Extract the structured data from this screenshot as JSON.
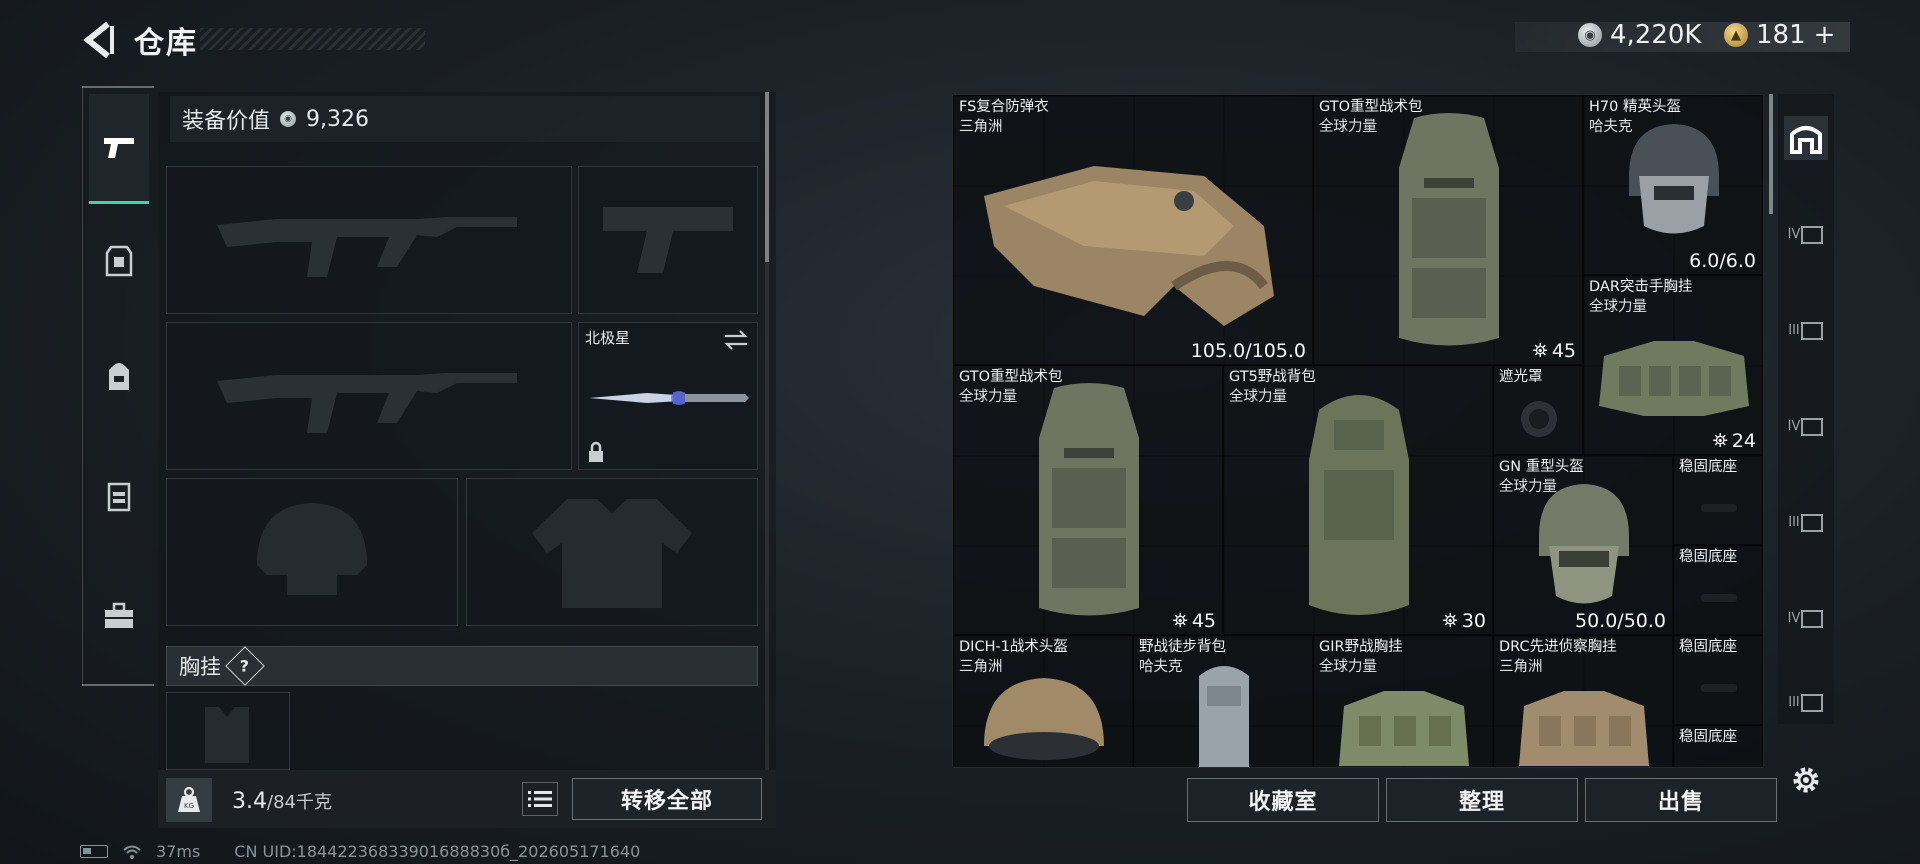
{
  "header": {
    "title": "仓库"
  },
  "currency": {
    "silver": "4,220K",
    "gold": "181",
    "gold_add": "+"
  },
  "left_panel": {
    "value_label": "装备价值",
    "value": "9,326",
    "melee_name": "北极星",
    "chest_label": "胸挂",
    "chest_help": "?",
    "weight_value": "3.4",
    "weight_cap": "/84千克",
    "transfer_all": "转移全部"
  },
  "footer": {
    "ping": "37ms",
    "uid": "CN UID:18442236833901688830б_202605171640"
  },
  "stash": {
    "items": [
      {
        "name": "FS复合防弹衣",
        "sub": "三角洲",
        "stat": "105.0/105.0",
        "rarity": "red",
        "icon": "body-armor-icon"
      },
      {
        "name": "GTO重型战术包",
        "sub": "全球力量",
        "stat": "45",
        "rarity": "red",
        "icon": "tactical-backpack-icon"
      },
      {
        "name": "H70 精英头盔",
        "sub": "哈夫克",
        "stat": "6.0/6.0",
        "rarity": "red",
        "icon": "elite-helmet-icon"
      },
      {
        "name": "DAR突击手胸挂",
        "sub": "全球力量",
        "stat": "24",
        "rarity": "red",
        "icon": "chest-rig-icon"
      },
      {
        "name": "GTO重型战术包",
        "sub": "全球力量",
        "stat": "45",
        "rarity": "red",
        "icon": "tactical-backpack-icon"
      },
      {
        "name": "GT5野战背包",
        "sub": "全球力量",
        "stat": "30",
        "rarity": "red",
        "icon": "field-backpack-icon"
      },
      {
        "name": "遮光罩",
        "sub": "",
        "stat": "",
        "rarity": "purple",
        "icon": "lens-hood-icon"
      },
      {
        "name": "GN 重型头盔",
        "sub": "全球力量",
        "stat": "50.0/50.0",
        "rarity": "purple",
        "icon": "heavy-helmet-icon"
      },
      {
        "name": "稳固底座",
        "sub": "",
        "stat": "",
        "rarity": "purple",
        "icon": "mount-icon"
      },
      {
        "name": "稳固底座",
        "sub": "",
        "stat": "",
        "rarity": "purple",
        "icon": "mount-icon"
      },
      {
        "name": "DICH-1战术头盔",
        "sub": "三角洲",
        "stat": "",
        "rarity": "purple",
        "icon": "tactical-helmet-icon"
      },
      {
        "name": "野战徒步背包",
        "sub": "哈夫克",
        "stat": "",
        "rarity": "purple",
        "icon": "hiking-backpack-icon"
      },
      {
        "name": "GIR野战胸挂",
        "sub": "全球力量",
        "stat": "",
        "rarity": "purple",
        "icon": "chest-rig-icon"
      },
      {
        "name": "DRC先进侦察胸挂",
        "sub": "三角洲",
        "stat": "",
        "rarity": "purple",
        "icon": "chest-rig-icon"
      },
      {
        "name": "稳固底座",
        "sub": "",
        "stat": "",
        "rarity": "purple",
        "icon": "mount-icon"
      },
      {
        "name": "稳固底座",
        "sub": "",
        "stat": "",
        "rarity": "purple",
        "icon": "mount-icon"
      }
    ],
    "buttons": {
      "collection": "收藏室",
      "sort": "整理",
      "sell": "出售"
    }
  },
  "right_rail": {
    "labels": [
      "IV",
      "III",
      "IV",
      "III",
      "IV",
      "III"
    ]
  },
  "colors": {
    "accent": "#3fd5a8",
    "red_rarity": "#5a2b30",
    "purple_rarity": "#383552"
  }
}
